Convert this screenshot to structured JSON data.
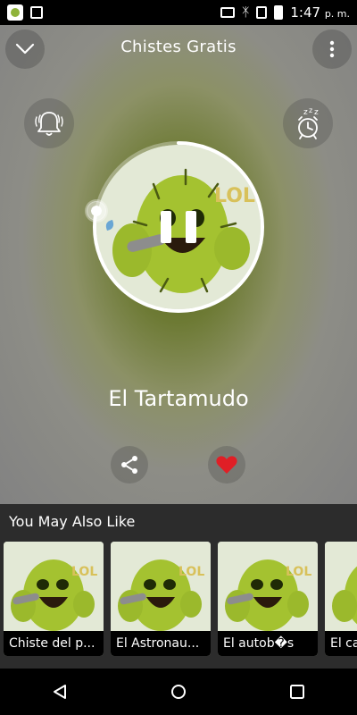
{
  "status_bar": {
    "time": "1:47",
    "ampm": "p. m."
  },
  "header": {
    "title": "Chistes Gratis",
    "collapse_icon": "chevron-down-icon",
    "more_icon": "more-vert-icon"
  },
  "controls": {
    "bell_icon": "bell-icon",
    "alarm_icon": "alarm-clock-icon",
    "share_icon": "share-icon",
    "favorite_icon": "heart-icon"
  },
  "player": {
    "track_title": "El Tartamudo",
    "progress_fraction": 0.78,
    "accent_color": "#ffffff",
    "favorite_color": "#e01f26"
  },
  "suggestions": {
    "title": "You May Also Like",
    "items": [
      {
        "label": "Chiste del p..."
      },
      {
        "label": "El Astronau..."
      },
      {
        "label": "El autob�s"
      },
      {
        "label": "El ca"
      }
    ]
  }
}
